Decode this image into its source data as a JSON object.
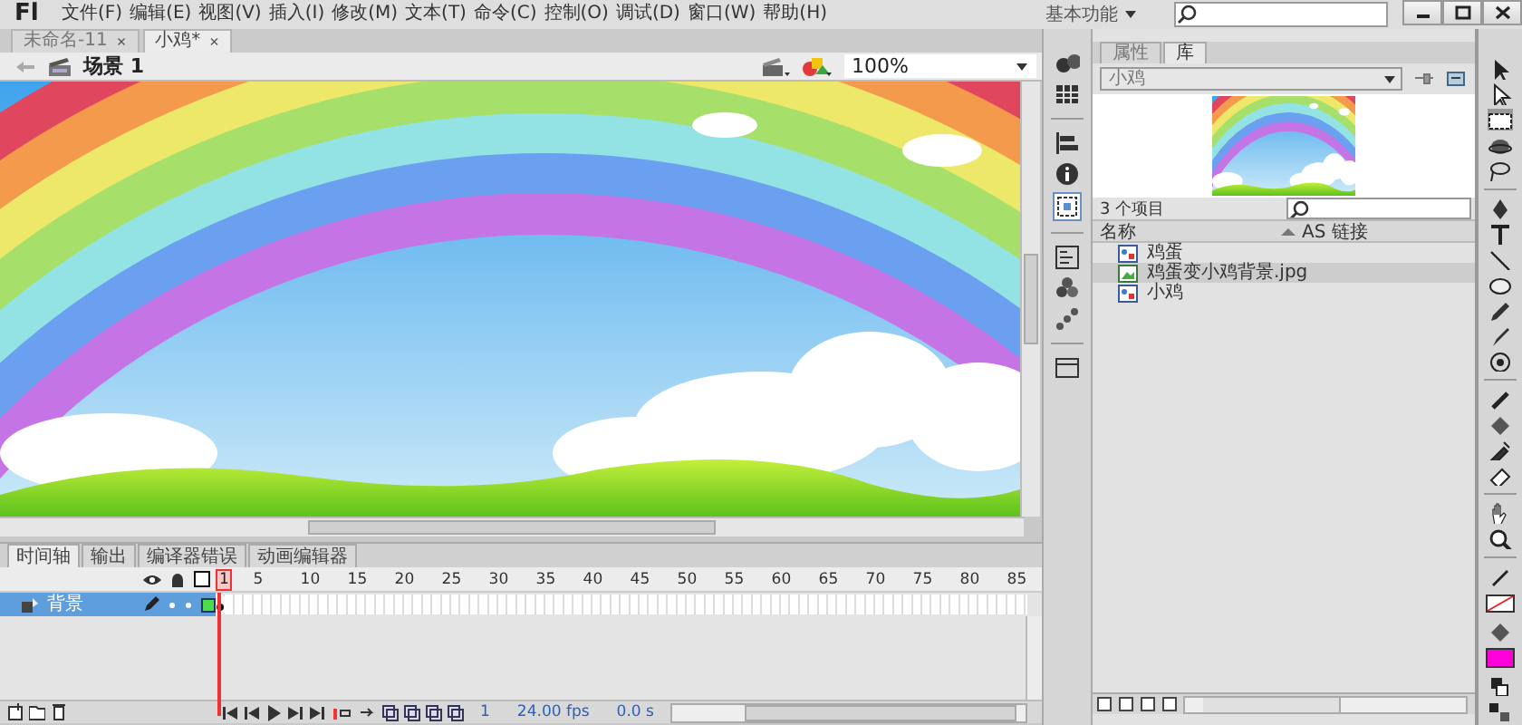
{
  "menu_bar": {
    "logo": "Fl",
    "menus": [
      "文件(F)",
      "编辑(E)",
      "视图(V)",
      "插入(I)",
      "修改(M)",
      "文本(T)",
      "命令(C)",
      "控制(O)",
      "调试(D)",
      "窗口(W)",
      "帮助(H)"
    ],
    "workspace": "基本功能"
  },
  "document_tabs": [
    {
      "label": "未命名-11",
      "close": "×",
      "selected": false
    },
    {
      "label": "小鸡*",
      "close": "×",
      "selected": true
    }
  ],
  "edit_bar": {
    "scene": "场景 1",
    "zoom": "100%"
  },
  "timeline": {
    "tabs": [
      {
        "label": "时间轴",
        "selected": true
      },
      {
        "label": "输出",
        "selected": false
      },
      {
        "label": "编译器错误",
        "selected": false
      },
      {
        "label": "动画编辑器",
        "selected": false
      }
    ],
    "frame_numbers": [
      "1",
      "5",
      "10",
      "15",
      "20",
      "25",
      "30",
      "35",
      "40",
      "45",
      "50",
      "55",
      "60",
      "65",
      "70",
      "75",
      "80",
      "85"
    ],
    "layers": [
      {
        "name": "背景",
        "selected": true
      }
    ],
    "current_frame": "1",
    "frame_rate": "24.00 fps",
    "elapsed_time": "0.0 s"
  },
  "library": {
    "tabs": [
      {
        "label": "属性",
        "selected": false
      },
      {
        "label": "库",
        "selected": true
      }
    ],
    "document": "小鸡",
    "item_count": "3 个项目",
    "columns": [
      "名称",
      "AS 链接"
    ],
    "items": [
      {
        "name": "鸡蛋",
        "kind": "symbol",
        "selected": false
      },
      {
        "name": "鸡蛋变小鸡背景.jpg",
        "kind": "bitmap",
        "selected": true
      },
      {
        "name": "小鸡",
        "kind": "symbol",
        "selected": false
      }
    ]
  }
}
